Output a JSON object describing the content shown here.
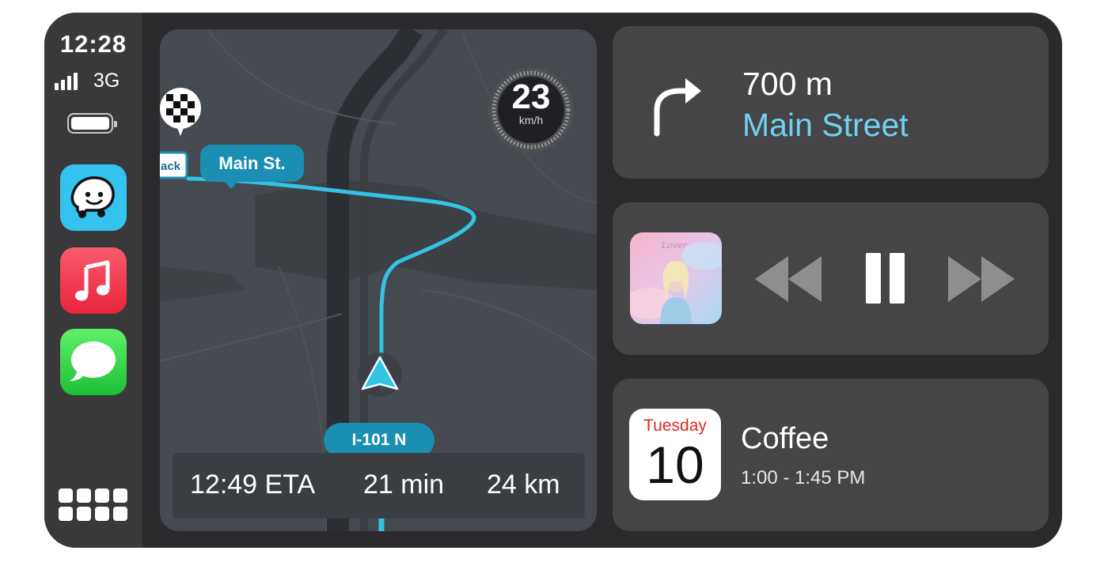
{
  "status": {
    "time": "12:28",
    "network": "3G"
  },
  "apps": [
    {
      "name": "Waze",
      "icon": "waze-icon"
    },
    {
      "name": "Music",
      "icon": "music-note-icon"
    },
    {
      "name": "Messages",
      "icon": "speech-bubble-icon"
    }
  ],
  "map": {
    "street_bubble": "Main St.",
    "highway_label": "I-101 N",
    "speed": "23",
    "speed_unit": "km/h",
    "eta": "12:49 ETA",
    "duration": "21 min",
    "distance": "24 km",
    "route_color": "#33c3e3"
  },
  "navigation": {
    "distance": "700 m",
    "street": "Main Street",
    "direction": "turn-right-icon"
  },
  "now_playing": {
    "album_text": "Lover",
    "controls": [
      "rewind-icon",
      "pause-icon",
      "fast-forward-icon"
    ]
  },
  "calendar": {
    "day": "Tuesday",
    "date": "10",
    "title": "Coffee",
    "time": "1:00 - 1:45 PM"
  }
}
